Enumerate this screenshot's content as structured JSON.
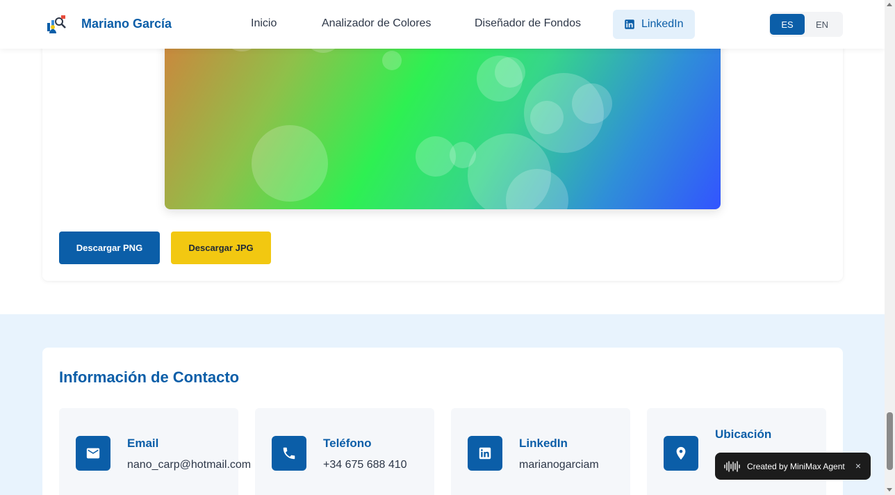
{
  "header": {
    "brand": "Mariano García",
    "nav": {
      "home": "Inicio",
      "color_analyzer": "Analizador de Colores",
      "background_designer": "Diseñador de Fondos",
      "linkedin": "LinkedIn"
    },
    "lang": {
      "es": "ES",
      "en": "EN",
      "active": "ES"
    }
  },
  "designer": {
    "download_png": "Descargar PNG",
    "download_jpg": "Descargar JPG",
    "gradient_colors": [
      "#d97a3a",
      "#8fc04a",
      "#2ef052",
      "#36d68a",
      "#2f8fd8",
      "#3254ff"
    ]
  },
  "contact": {
    "title": "Información de Contacto",
    "items": [
      {
        "label": "Email",
        "value": "nano_carp@hotmail.com",
        "icon": "mail-icon"
      },
      {
        "label": "Teléfono",
        "value": "+34 675 688 410",
        "icon": "phone-icon"
      },
      {
        "label": "LinkedIn",
        "value": "marianogarciam",
        "icon": "linkedin-icon"
      },
      {
        "label": "Ubicación",
        "value": "",
        "icon": "location-icon"
      }
    ]
  },
  "toast": {
    "text": "Created by MiniMax Agent",
    "close": "×"
  },
  "colors": {
    "primary": "#0b5ea8",
    "accent": "#f2c811",
    "section_bg": "#e8f3fd"
  }
}
